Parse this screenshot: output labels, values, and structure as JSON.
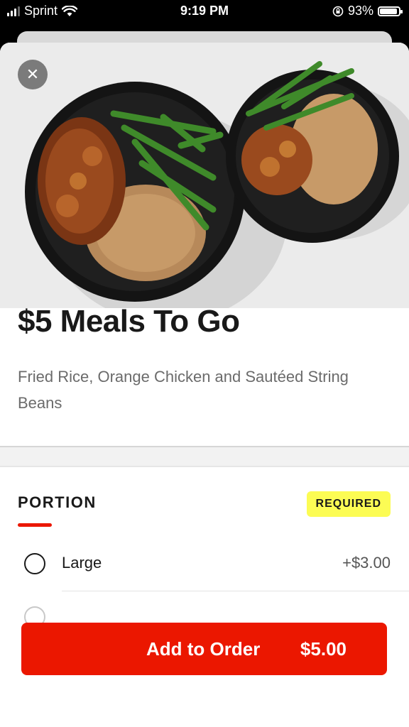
{
  "status_bar": {
    "carrier": "Sprint",
    "time": "9:19 PM",
    "battery": "93%",
    "battery_level": 0.93
  },
  "item": {
    "title": "$5 Meals To Go",
    "description": "Fried Rice, Orange Chicken and Sautéed String Beans"
  },
  "section": {
    "title": "PORTION",
    "required_label": "REQUIRED",
    "options": [
      {
        "label": "Large",
        "price": "+$3.00",
        "selected": false
      }
    ]
  },
  "order_button": {
    "label": "Add to Order",
    "price": "$5.00"
  },
  "colors": {
    "accent": "#eb1700",
    "required_badge": "#fcfc54"
  },
  "icons": [
    "wifi-icon",
    "orientation-lock-icon",
    "close-icon"
  ]
}
